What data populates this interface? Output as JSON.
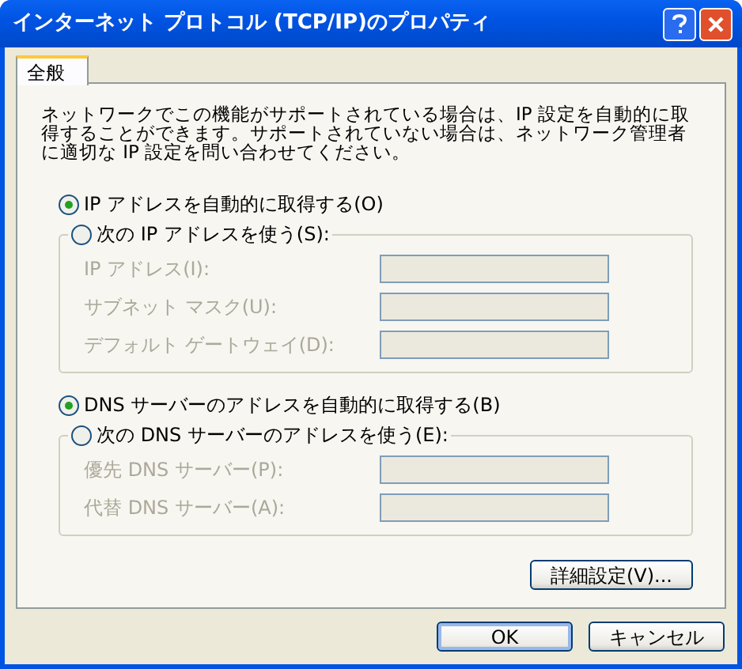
{
  "window": {
    "title": "インターネット プロトコル (TCP/IP)のプロパティ"
  },
  "tabs": [
    {
      "label": "全般",
      "selected": true
    }
  ],
  "description": "ネットワークでこの機能がサポートされている場合は、IP 設定を自動的に取得することができます。サポートされていない場合は、ネットワーク管理者に適切な IP 設定を問い合わせてください。",
  "sections": [
    {
      "auto": {
        "label": "IP アドレスを自動的に取得する(O)",
        "selected": true
      },
      "manual": {
        "label": "次の IP アドレスを使う(S):",
        "selected": false
      },
      "fields": [
        {
          "label": "IP アドレス(I):",
          "disabled": true
        },
        {
          "label": "サブネット マスク(U):",
          "disabled": true
        },
        {
          "label": "デフォルト ゲートウェイ(D):",
          "disabled": true
        }
      ]
    },
    {
      "auto": {
        "label": "DNS サーバーのアドレスを自動的に取得する(B)",
        "selected": true
      },
      "manual": {
        "label": "次の DNS サーバーのアドレスを使う(E):",
        "selected": false
      },
      "fields": [
        {
          "label": "優先 DNS サーバー(P):",
          "disabled": true
        },
        {
          "label": "代替 DNS サーバー(A):",
          "disabled": true
        }
      ]
    }
  ],
  "advanced_button": "詳細設定(V)...",
  "buttons": [
    {
      "label": "OK",
      "default": true
    },
    {
      "label": "キャンセル",
      "default": false
    }
  ]
}
